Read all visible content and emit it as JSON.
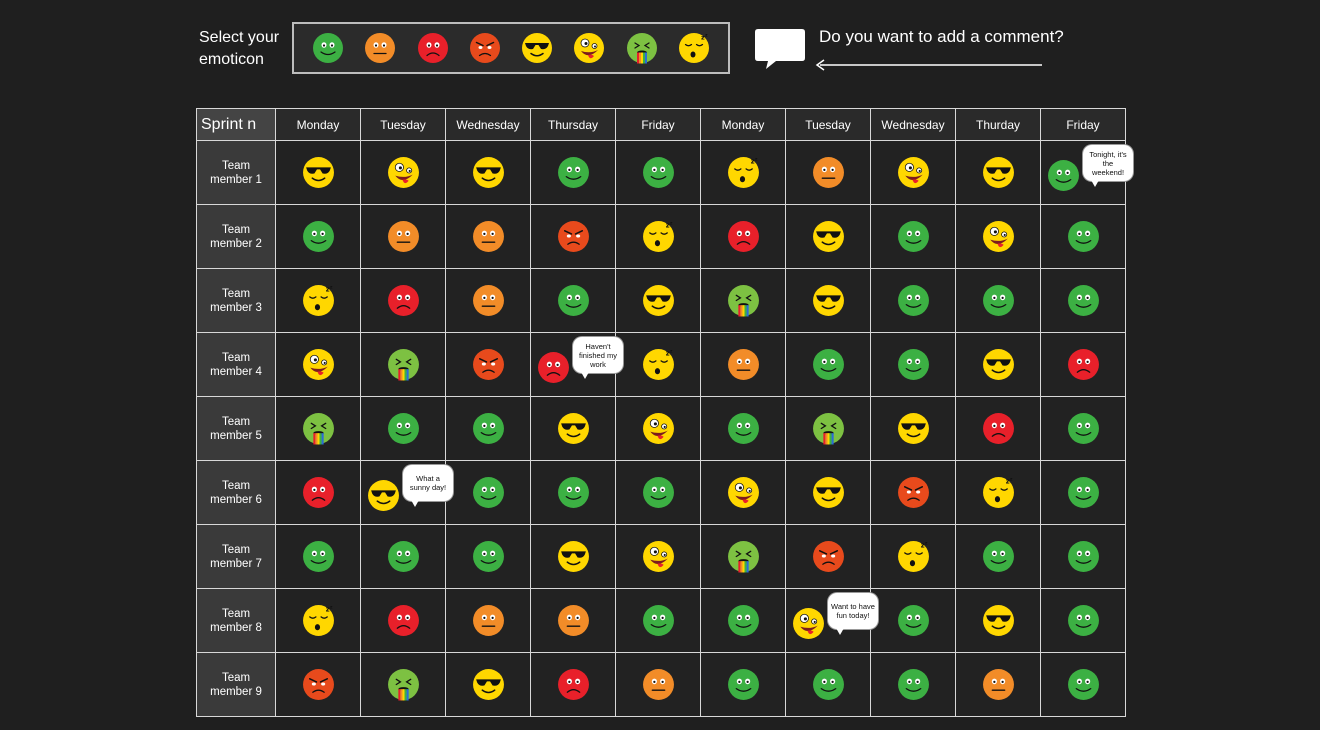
{
  "header": {
    "select_label": "Select your\nemoticon",
    "comment_question": "Do you want to add a comment?",
    "palette": [
      "happy",
      "neutral",
      "sad",
      "angry",
      "cool",
      "silly",
      "sick",
      "sleepy"
    ]
  },
  "grid": {
    "corner_label": "Sprint n",
    "days": [
      "Monday",
      "Tuesday",
      "Wednesday",
      "Thursday",
      "Friday",
      "Monday",
      "Tuesday",
      "Wednesday",
      "Thurday",
      "Friday"
    ],
    "members": [
      {
        "name": "Team\nmember 1",
        "cells": [
          "cool",
          "silly",
          "cool",
          "happy",
          "happy",
          "sleepy",
          "neutral",
          "silly",
          "cool",
          "happy"
        ]
      },
      {
        "name": "Team\nmember 2",
        "cells": [
          "happy",
          "neutral",
          "neutral",
          "angry",
          "sleepy",
          "sad",
          "cool",
          "happy",
          "silly",
          "happy"
        ]
      },
      {
        "name": "Team\nmember 3",
        "cells": [
          "sleepy",
          "sad",
          "neutral",
          "happy",
          "cool",
          "sick",
          "cool",
          "happy",
          "happy",
          "happy"
        ]
      },
      {
        "name": "Team\nmember 4",
        "cells": [
          "silly",
          "sick",
          "angry",
          "sad",
          "sleepy",
          "neutral",
          "happy",
          "happy",
          "cool",
          "sad"
        ]
      },
      {
        "name": "Team\nmember 5",
        "cells": [
          "sick",
          "happy",
          "happy",
          "cool",
          "silly",
          "happy",
          "sick",
          "cool",
          "sad",
          "happy"
        ]
      },
      {
        "name": "Team\nmember 6",
        "cells": [
          "sad",
          "cool",
          "happy",
          "happy",
          "happy",
          "silly",
          "cool",
          "angry",
          "sleepy",
          "happy"
        ]
      },
      {
        "name": "Team\nmember 7",
        "cells": [
          "happy",
          "happy",
          "happy",
          "cool",
          "silly",
          "sick",
          "angry",
          "sleepy",
          "happy",
          "happy"
        ]
      },
      {
        "name": "Team\nmember 8",
        "cells": [
          "sleepy",
          "sad",
          "neutral",
          "neutral",
          "happy",
          "happy",
          "silly",
          "happy",
          "cool",
          "happy"
        ]
      },
      {
        "name": "Team\nmember 9",
        "cells": [
          "angry",
          "sick",
          "cool",
          "sad",
          "neutral",
          "happy",
          "happy",
          "happy",
          "neutral",
          "happy"
        ]
      }
    ],
    "comments": [
      {
        "row": 0,
        "col": 9,
        "text": "Tonight, it's the weekend!"
      },
      {
        "row": 3,
        "col": 3,
        "text": "Haven't finished my work"
      },
      {
        "row": 5,
        "col": 1,
        "text": "What a sunny day!"
      },
      {
        "row": 7,
        "col": 6,
        "text": "Want to have fun today!"
      }
    ]
  },
  "colors": {
    "background": "#1f1f1f",
    "happy": "#3cb043",
    "neutral": "#f28c28",
    "sad": "#e8202a",
    "angry": "#e84a1c",
    "yellow": "#ffd700",
    "sick": "#7dc142"
  }
}
